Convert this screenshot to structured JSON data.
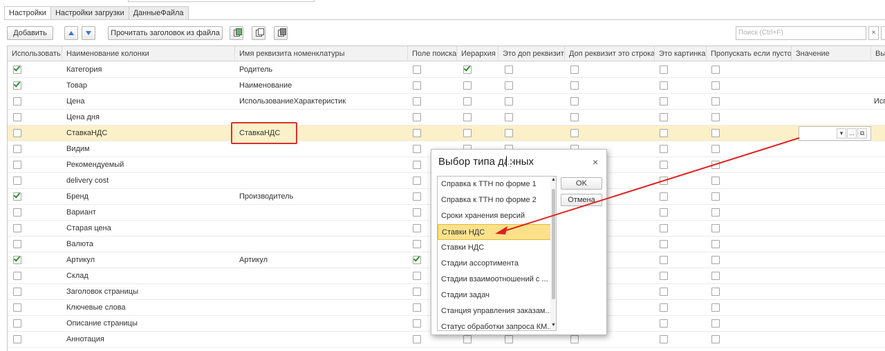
{
  "tabs": [
    "Настройки",
    "Настройки загрузки",
    "ДанныеФайла"
  ],
  "toolbar": {
    "add_label": "Добавить",
    "read_header_label": "Прочитать заголовок из файла",
    "up_icon": "arrow-up-icon",
    "down_icon": "arrow-down-icon"
  },
  "search": {
    "placeholder": "Поиск (Ctrl+F)",
    "clear": "×"
  },
  "columns": [
    "Использовать",
    "Наименование колонки",
    "Имя реквизита номенклатуры",
    "Поле поиска",
    "Иерархия",
    "Это доп реквизит",
    "Доп реквизит это строка",
    "Это картинка",
    "Пропускать если пусто",
    "Значение",
    "Вы"
  ],
  "rows": [
    {
      "use": true,
      "name": "Категория",
      "attr": "Родитель",
      "hier": true,
      "search": false,
      "extra": ""
    },
    {
      "use": true,
      "name": "Товар",
      "attr": "Наименование",
      "hier": false,
      "search": false,
      "extra": ""
    },
    {
      "use": false,
      "name": "Цена",
      "attr": "ИспользованиеХарактеристик",
      "hier": false,
      "search": false,
      "extra": "Исп"
    },
    {
      "use": false,
      "name": "Цена дня",
      "attr": "",
      "hier": false,
      "search": false,
      "extra": ""
    },
    {
      "use": false,
      "name": "СтавкаНДС",
      "attr": "СтавкаНДС",
      "hier": false,
      "search": false,
      "extra": ""
    },
    {
      "use": false,
      "name": "Видим",
      "attr": "",
      "hier": false,
      "search": false,
      "extra": ""
    },
    {
      "use": false,
      "name": "Рекомендуемый",
      "attr": "",
      "hier": false,
      "search": false,
      "extra": ""
    },
    {
      "use": false,
      "name": "delivery cost",
      "attr": "",
      "hier": false,
      "search": false,
      "extra": ""
    },
    {
      "use": true,
      "name": "Бренд",
      "attr": "Производитель",
      "hier": false,
      "search": false,
      "extra": ""
    },
    {
      "use": false,
      "name": "Вариант",
      "attr": "",
      "hier": false,
      "search": false,
      "extra": ""
    },
    {
      "use": false,
      "name": "Старая цена",
      "attr": "",
      "hier": false,
      "search": false,
      "extra": ""
    },
    {
      "use": false,
      "name": "Валюта",
      "attr": "",
      "hier": false,
      "search": false,
      "extra": ""
    },
    {
      "use": true,
      "name": "Артикул",
      "attr": "Артикул",
      "hier": false,
      "search": true,
      "extra": ""
    },
    {
      "use": false,
      "name": "Склад",
      "attr": "",
      "hier": false,
      "search": false,
      "extra": ""
    },
    {
      "use": false,
      "name": "Заголовок страницы",
      "attr": "",
      "hier": false,
      "search": false,
      "extra": ""
    },
    {
      "use": false,
      "name": "Ключевые слова",
      "attr": "",
      "hier": false,
      "search": false,
      "extra": ""
    },
    {
      "use": false,
      "name": "Описание страницы",
      "attr": "",
      "hier": false,
      "search": false,
      "extra": ""
    },
    {
      "use": false,
      "name": "Аннотация",
      "attr": "",
      "hier": false,
      "search": false,
      "extra": ""
    }
  ],
  "value_field": {
    "dropdown": "▾",
    "more": "...",
    "open": "⧉"
  },
  "dialog": {
    "title": "Выбор типа данных",
    "close": "×",
    "ok": "OK",
    "cancel": "Отмена",
    "items": [
      "Справка к ТТН по форме 1",
      "Справка к ТТН по форме 2",
      "Сроки хранения версий",
      "Ставки НДС",
      "Ставки НДС",
      "Стадии ассортимента",
      "Стадии взаимоотношений с ...",
      "Стадии задач",
      "Станция управления заказам...",
      "Статус обработки запроса КМ..."
    ],
    "selected_index": 3
  },
  "colors": {
    "selected_row": "#fbf0c7",
    "highlight_box": "#d9322e",
    "arrow": "#e0201c",
    "list_selected": "#fbe28a",
    "check": "#2a8f2a"
  }
}
